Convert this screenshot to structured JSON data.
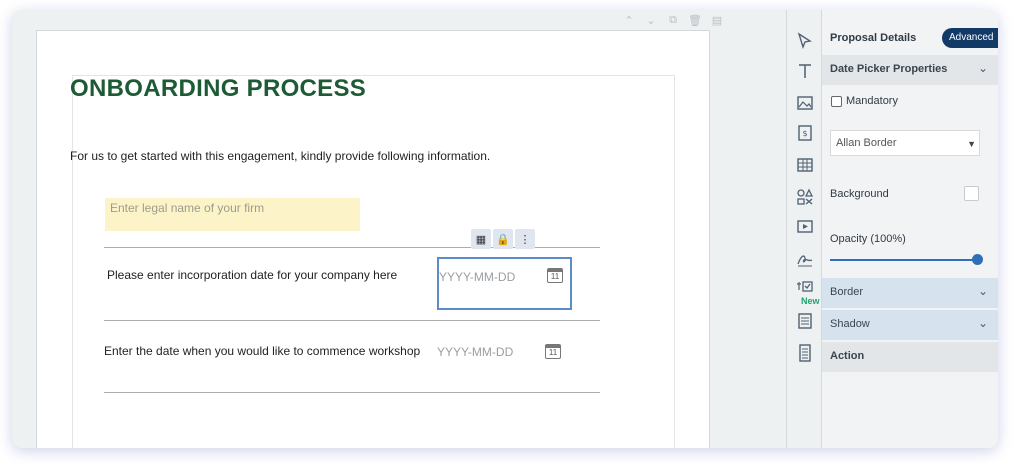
{
  "document": {
    "toolbar": {
      "up": "⌃",
      "down": "⌄",
      "copy": "⧉",
      "delete": "🗑",
      "file": "▤"
    },
    "title": "ONBOARDING PROCESS",
    "intro": "For us to get started with this engagement, kindly provide following information.",
    "firm_placeholder": "Enter legal name of your firm",
    "q1_label": "Please enter incorporation date for your company here",
    "q1_placeholder": "YYYY-MM-DD",
    "q2_label": "Enter the date when you would like to commence workshop",
    "q2_placeholder": "YYYY-MM-DD",
    "calendar_day": "11",
    "mini_tools": {
      "table": "▦",
      "lock": "🔒",
      "more": "⋮"
    }
  },
  "rail": {
    "icons": [
      "cursor-icon",
      "text-icon",
      "image-icon",
      "pricing-icon",
      "table-icon",
      "shapes-icon",
      "video-icon",
      "signature-icon",
      "checklist-icon",
      "fields-icon",
      "form-icon"
    ],
    "new_badge": "New"
  },
  "props": {
    "header": "Proposal Details",
    "advanced": "Advanced",
    "section_title": "Date Picker Properties",
    "mandatory": "Mandatory",
    "border_style": "Allan Border",
    "background": "Background",
    "opacity": "Opacity (100%)",
    "opacity_value": 1.0,
    "border": "Border",
    "shadow": "Shadow",
    "action": "Action"
  }
}
